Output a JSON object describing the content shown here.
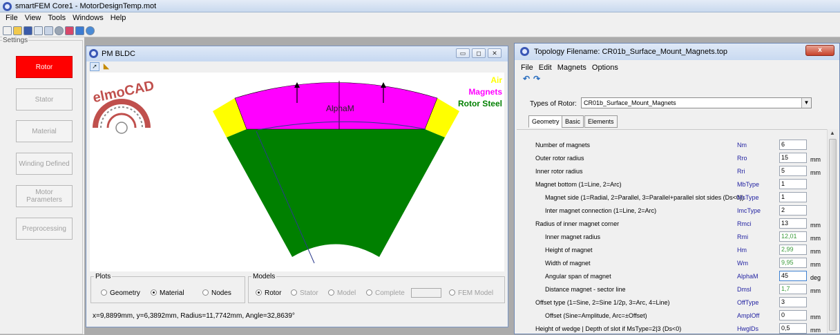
{
  "app": {
    "title": "smartFEM Core1 - MotorDesignTemp.mot"
  },
  "menu": [
    "File",
    "View",
    "Tools",
    "Windows",
    "Help"
  ],
  "settings": {
    "legend": "Settings",
    "buttons": [
      "Rotor",
      "Stator",
      "Material",
      "Winding Defined",
      "Motor Parameters",
      "Preprocessing"
    ]
  },
  "child": {
    "title": "PM BLDC",
    "logo": "elmoCAD",
    "legend": [
      {
        "label": "Air",
        "color": "#ffff00"
      },
      {
        "label": "Magnets",
        "color": "#ff00ff"
      },
      {
        "label": "Rotor Steel",
        "color": "#008000"
      }
    ],
    "alpha_label": "AlphaM",
    "plots": {
      "legend": "Plots",
      "options": [
        "Geometry",
        "Material",
        "Nodes"
      ],
      "selected": "Material"
    },
    "models": {
      "legend": "Models",
      "options": [
        "Rotor",
        "Stator",
        "Model",
        "Complete",
        "FEM Model"
      ],
      "selected": "Rotor"
    },
    "status": "x=9,8899mm,  y=6,3892mm,  Radius=11,7742mm,  Angle=32,8639°"
  },
  "topology": {
    "title": "Topology Filename: CR01b_Surface_Mount_Magnets.top",
    "close": "x",
    "menu": [
      "File",
      "Edit",
      "Magnets",
      "Options"
    ],
    "types_label": "Types of Rotor:",
    "types_value": "CR01b_Surface_Mount_Magnets",
    "tabs": [
      "Geometry",
      "Basic",
      "Elements"
    ],
    "rows": [
      {
        "label": "Number of magnets",
        "symbol": "Nm",
        "value": "6",
        "unit": "",
        "green": false,
        "indent": false
      },
      {
        "label": "Outer rotor radius",
        "symbol": "Rro",
        "value": "15",
        "unit": "mm",
        "green": false,
        "indent": false
      },
      {
        "label": "Inner rotor radius",
        "symbol": "Rri",
        "value": "5",
        "unit": "mm",
        "green": false,
        "indent": false
      },
      {
        "label": "Magnet bottom (1=Line, 2=Arc)",
        "symbol": "MbType",
        "value": "1",
        "unit": "",
        "green": false,
        "indent": false
      },
      {
        "label": "Magnet side (1=Radial, 2=Parallel, 3=Parallel+parallel slot sides (Ds<0))",
        "symbol": "MsType",
        "value": "1",
        "unit": "",
        "green": false,
        "indent": true
      },
      {
        "label": "Inter magnet connection (1=Line, 2=Arc)",
        "symbol": "ImcType",
        "value": "2",
        "unit": "",
        "green": false,
        "indent": true
      },
      {
        "label": "Radius of inner magnet corner",
        "symbol": "Rmci",
        "value": "13",
        "unit": "mm",
        "green": false,
        "indent": false
      },
      {
        "label": "Inner magnet radius",
        "symbol": "Rmi",
        "value": "12,01",
        "unit": "mm",
        "green": true,
        "indent": true
      },
      {
        "label": "Height of magnet",
        "symbol": "Hm",
        "value": "2,99",
        "unit": "mm",
        "green": true,
        "indent": true
      },
      {
        "label": "Width of magnet",
        "symbol": "Wm",
        "value": "9,95",
        "unit": "mm",
        "green": true,
        "indent": true
      },
      {
        "label": "Angular span of magnet",
        "symbol": "AlphaM",
        "value": "45",
        "unit": "deg",
        "green": false,
        "indent": true
      },
      {
        "label": "Distance magnet - sector line",
        "symbol": "Dmsl",
        "value": "1,7",
        "unit": "mm",
        "green": true,
        "indent": true
      },
      {
        "label": "Offset type (1=Sine, 2=Sine 1/2p, 3=Arc, 4=Line)",
        "symbol": "OffType",
        "value": "3",
        "unit": "",
        "green": false,
        "indent": false
      },
      {
        "label": "Offset (Sine=Amplitude, Arc=±Offset)",
        "symbol": "AmplOff",
        "value": "0",
        "unit": "mm",
        "green": false,
        "indent": true
      },
      {
        "label": "Height of wedge | Depth of slot if MsType=2|3 (Ds<0)",
        "symbol": "HwglDs",
        "value": "0,5",
        "unit": "mm",
        "green": false,
        "indent": false
      }
    ]
  }
}
